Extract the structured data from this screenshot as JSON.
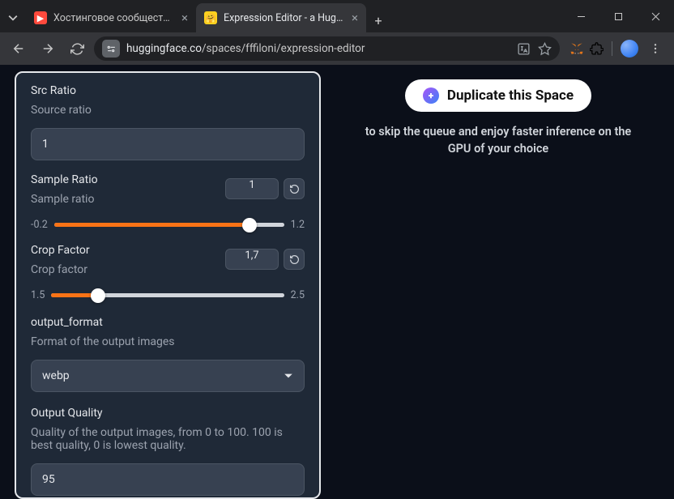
{
  "browser": {
    "tabs": [
      {
        "title": "Хостинговое сообщество «Tim"
      },
      {
        "title": "Expression Editor - a Hugging F"
      }
    ],
    "url_domain": "huggingface.co",
    "url_path": "/spaces/fffiloni/expression-editor"
  },
  "panel": {
    "src_ratio": {
      "title": "Src Ratio",
      "desc": "Source ratio",
      "value": "1"
    },
    "sample_ratio": {
      "title": "Sample Ratio",
      "desc": "Sample ratio",
      "value": "1",
      "min": "-0.2",
      "max": "1.2",
      "fill_pct": 85
    },
    "crop_factor": {
      "title": "Crop Factor",
      "desc": "Crop factor",
      "value": "1,7",
      "min": "1.5",
      "max": "2.5",
      "fill_pct": 20
    },
    "output_format": {
      "title": "output_format",
      "desc": "Format of the output images",
      "value": "webp"
    },
    "output_quality": {
      "title": "Output Quality",
      "desc": "Quality of the output images, from 0 to 100. 100 is best quality, 0 is lowest quality.",
      "value": "95"
    }
  },
  "right": {
    "button": "Duplicate this Space",
    "sub": "to skip the queue and enjoy faster inference on the GPU of your choice"
  }
}
